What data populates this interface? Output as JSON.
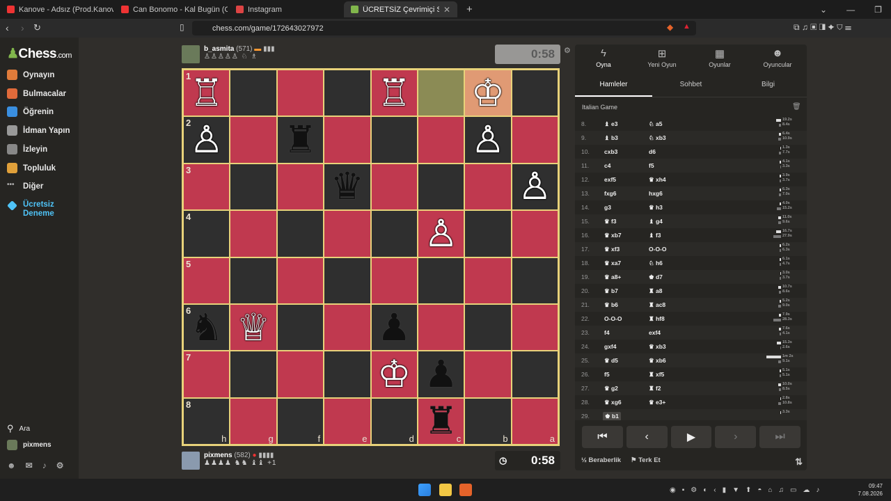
{
  "browser": {
    "tabs": [
      {
        "title": "Kanove - Adsız (Prod.Kanove) - YouTube",
        "color": "#e33"
      },
      {
        "title": "Can Bonomo - Kal Bugün (Official",
        "color": "#e33"
      },
      {
        "title": "Instagram",
        "color": "#d44"
      },
      {
        "title": "ÜCRETSİZ Çevrimiçi Satranç Oyna",
        "color": "#81b64c"
      }
    ],
    "url": "chess.com/game/172643027972"
  },
  "sidebar": {
    "logo": "Chess",
    "logo_suffix": ".com",
    "items": [
      {
        "label": "Oynayın",
        "icon": "play-icon",
        "color": "#e07b3a"
      },
      {
        "label": "Bulmacalar",
        "icon": "puzzle-icon",
        "color": "#e06a3a"
      },
      {
        "label": "Öğrenin",
        "icon": "learn-icon",
        "color": "#3a8fe0"
      },
      {
        "label": "İdman Yapın",
        "icon": "train-icon",
        "color": "#999"
      },
      {
        "label": "İzleyin",
        "icon": "watch-icon",
        "color": "#888"
      },
      {
        "label": "Topluluk",
        "icon": "community-icon",
        "color": "#e0a03a"
      },
      {
        "label": "Diğer",
        "icon": "more-icon",
        "color": "#aaa"
      },
      {
        "label": "Ücretsiz Deneme",
        "icon": "diamond-icon",
        "color": "#4fc3f7"
      }
    ],
    "search": "Ara",
    "user": "pixmens"
  },
  "top_player": {
    "name": "b_asmita",
    "rating": "(571)",
    "clock": "0:58"
  },
  "bottom_player": {
    "name": "pixmens",
    "rating": "(582)",
    "clock": "0:58",
    "extra": "+1"
  },
  "board": {
    "ranks": [
      "1",
      "2",
      "3",
      "4",
      "5",
      "6",
      "7",
      "8"
    ],
    "files": [
      "h",
      "g",
      "f",
      "e",
      "d",
      "c",
      "b",
      "a"
    ],
    "squares": [
      [
        "r:R:w",
        "d:",
        "r:",
        "d:",
        "r:R:w",
        "hl:",
        "hk:K:w",
        "d:"
      ],
      [
        "d:P:w",
        "r:",
        "d:R:b",
        "r:",
        "d:",
        "r:",
        "d:P:w",
        "r:"
      ],
      [
        "r:",
        "d:",
        "r:",
        "d:Q:b",
        "r:",
        "d:",
        "r:",
        "d:P:w"
      ],
      [
        "d:",
        "r:",
        "d:",
        "r:",
        "d:",
        "r:P:w",
        "d:",
        "r:"
      ],
      [
        "r:",
        "d:",
        "r:",
        "d:",
        "r:",
        "d:",
        "r:",
        "d:"
      ],
      [
        "d:N:b",
        "r:Q:w",
        "d:",
        "r:",
        "d:P:b",
        "r:",
        "d:",
        "r:"
      ],
      [
        "r:",
        "d:",
        "r:",
        "d:",
        "r:K:w",
        "d:P:b",
        "r:",
        "d:"
      ],
      [
        "d:",
        "r:",
        "d:",
        "r:",
        "d:",
        "r:R:b",
        "d:",
        "r:"
      ]
    ]
  },
  "panel": {
    "top_tabs": [
      "Oyna",
      "Yeni Oyun",
      "Oyunlar",
      "Oyuncular"
    ],
    "tabs": [
      "Hamleler",
      "Sohbet",
      "Bilgi"
    ],
    "opening": "Italian Game",
    "moves": [
      {
        "n": "8.",
        "w": "♝ e3",
        "b": "♘ a5",
        "tw": "19.2s",
        "tb": "8.4s",
        "pw": 0.3,
        "pb": 0.15
      },
      {
        "n": "9.",
        "w": "♝ b3",
        "b": "♘ xb3",
        "tw": "6.4s",
        "tb": "10.9s",
        "pw": 0.12,
        "pb": 0.2
      },
      {
        "n": "10.",
        "w": "cxb3",
        "b": "d6",
        "tw": "1.3s",
        "tb": "7.7s",
        "pw": 0.03,
        "pb": 0.14
      },
      {
        "n": "11.",
        "w": "c4",
        "b": "f5",
        "tw": "4.1s",
        "tb": "3.3s",
        "pw": 0.08,
        "pb": 0.06
      },
      {
        "n": "12.",
        "w": "exf5",
        "b": "♛ xh4",
        "tw": "3.9s",
        "tb": "3.7s",
        "pw": 0.07,
        "pb": 0.07
      },
      {
        "n": "13.",
        "w": "fxg6",
        "b": "hxg6",
        "tw": "6.3s",
        "tb": "7.0s",
        "pw": 0.11,
        "pb": 0.13
      },
      {
        "n": "14.",
        "w": "g3",
        "b": "♛ h3",
        "tw": "4.0s",
        "tb": "15.2s",
        "pw": 0.07,
        "pb": 0.27
      },
      {
        "n": "15.",
        "w": "♛ f3",
        "b": "♝ g4",
        "tw": "11.0s",
        "tb": "9.6s",
        "pw": 0.2,
        "pb": 0.17
      },
      {
        "n": "16.",
        "w": "♛ xb7",
        "b": "♝ f3",
        "tw": "16.7s",
        "tb": "27.9s",
        "pw": 0.3,
        "pb": 0.5
      },
      {
        "n": "17.",
        "w": "♛ xf3",
        "b": "O-O-O",
        "tw": "6.2s",
        "tb": "6.3s",
        "pw": 0.11,
        "pb": 0.11
      },
      {
        "n": "18.",
        "w": "♛ xa7",
        "b": "♘ h6",
        "tw": "6.1s",
        "tb": "4.7s",
        "pw": 0.11,
        "pb": 0.09
      },
      {
        "n": "19.",
        "w": "♛ a8+",
        "b": "♚ d7",
        "tw": "3.0s",
        "tb": "3.7s",
        "pw": 0.05,
        "pb": 0.07
      },
      {
        "n": "20.",
        "w": "♛ b7",
        "b": "♜ a8",
        "tw": "10.7s",
        "tb": "8.6s",
        "pw": 0.19,
        "pb": 0.15
      },
      {
        "n": "21.",
        "w": "♛ b6",
        "b": "♜ ac8",
        "tw": "5.2s",
        "tb": "9.0s",
        "pw": 0.09,
        "pb": 0.16
      },
      {
        "n": "22.",
        "w": "O-O-O",
        "b": "♜ hf8",
        "tw": "7.9s",
        "tb": "28.3s",
        "pw": 0.14,
        "pb": 0.5
      },
      {
        "n": "23.",
        "w": "f4",
        "b": "exf4",
        "tw": "7.6s",
        "tb": "4.1s",
        "pw": 0.14,
        "pb": 0.07
      },
      {
        "n": "24.",
        "w": "gxf4",
        "b": "♛ xb3",
        "tw": "15.3s",
        "tb": "2.6s",
        "pw": 0.27,
        "pb": 0.05
      },
      {
        "n": "25.",
        "w": "♛ d5",
        "b": "♛ xb6",
        "tw": "1m 2s",
        "tb": "9.1s",
        "pw": 0.95,
        "pb": 0.16
      },
      {
        "n": "26.",
        "w": "f5",
        "b": "♜ xf5",
        "tw": "5.1s",
        "tb": "5.1s",
        "pw": 0.09,
        "pb": 0.09
      },
      {
        "n": "27.",
        "w": "♛ g2",
        "b": "♜ f2",
        "tw": "10.0s",
        "tb": "8.5s",
        "pw": 0.18,
        "pb": 0.15
      },
      {
        "n": "28.",
        "w": "♛ xg6",
        "b": "♛ e3+",
        "tw": "2.8s",
        "tb": "10.8s",
        "pw": 0.05,
        "pb": 0.19
      },
      {
        "n": "29.",
        "w": "♚ b1",
        "b": "",
        "tw": "3.3s",
        "tb": "",
        "pw": 0.06,
        "pb": 0
      }
    ],
    "draw": "½ Beraberlik",
    "resign": "Terk Et"
  },
  "taskbar": {
    "time": "09:47",
    "date": "7.08.2026"
  }
}
